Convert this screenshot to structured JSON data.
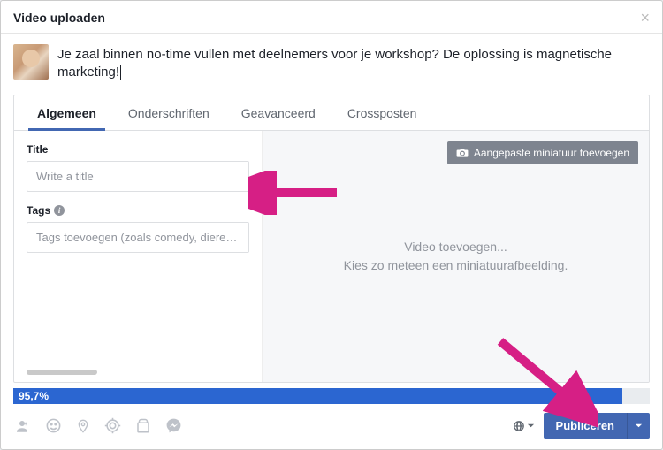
{
  "modal": {
    "title": "Video uploaden",
    "post_text": "Je zaal binnen no-time vullen met deelnemers voor je workshop? De oplossing is magnetische marketing!"
  },
  "tabs": [
    {
      "label": "Algemeen",
      "active": true
    },
    {
      "label": "Onderschriften",
      "active": false
    },
    {
      "label": "Geavanceerd",
      "active": false
    },
    {
      "label": "Crossposten",
      "active": false
    }
  ],
  "fields": {
    "title_label": "Title",
    "title_placeholder": "Write a title",
    "tags_label": "Tags",
    "tags_placeholder": "Tags toevoegen (zoals comedy, dieren, make-"
  },
  "right": {
    "thumb_button": "Aangepaste miniatuur toevoegen",
    "placeholder_line1": "Video toevoegen...",
    "placeholder_line2": "Kies zo meteen een miniatuurafbeelding."
  },
  "progress": {
    "percent_label": "95,7%",
    "percent_width": "95.7%"
  },
  "footer": {
    "publish_label": "Publiceren"
  }
}
